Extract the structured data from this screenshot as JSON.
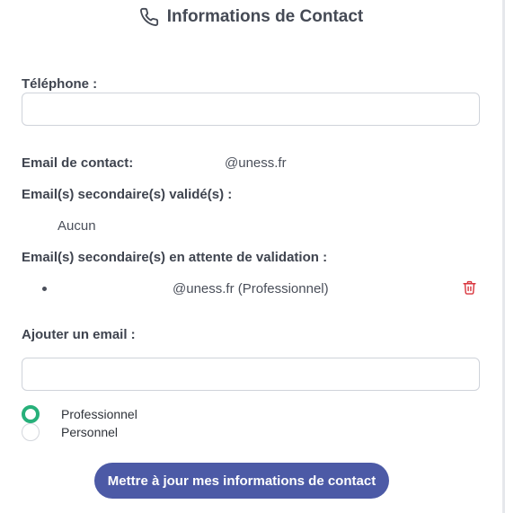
{
  "header": {
    "title": "Informations de Contact",
    "icon": "phone-icon"
  },
  "phone": {
    "label": "Téléphone :",
    "value": "",
    "placeholder": ""
  },
  "email_contact": {
    "label": "Email de contact:",
    "value": "@uness.fr"
  },
  "secondary_validated": {
    "label": "Email(s) secondaire(s) validé(s) :",
    "value": "Aucun"
  },
  "secondary_pending": {
    "label": "Email(s) secondaire(s) en attente de validation :",
    "items": [
      {
        "text": "@uness.fr (Professionnel)"
      }
    ]
  },
  "add_email": {
    "label": "Ajouter un email :",
    "value": "",
    "placeholder": "",
    "options": [
      {
        "label": "Professionnel",
        "checked": true
      },
      {
        "label": "Personnel",
        "checked": false
      }
    ]
  },
  "submit_label": "Mettre à jour mes informations de contact",
  "colors": {
    "accent": "#4c5aa6",
    "radio_checked": "#27b07a",
    "delete": "#d9363e"
  }
}
